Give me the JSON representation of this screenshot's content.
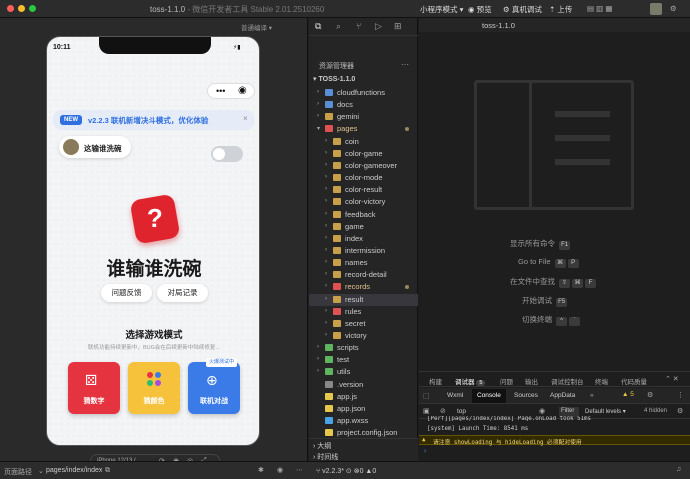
{
  "window": {
    "title": "toss-1.1.0",
    "subtitle": "- 微信开发者工具 Stable 2.01.2510260",
    "mode_select": "小程序模式",
    "preview_label": "预览",
    "real_debug_label": "真机调试",
    "upload_label": "上传",
    "compile_mode": "普通编译"
  },
  "editor_tab": "toss-1.1.0",
  "phone": {
    "time": "10:11",
    "banner_badge": "NEW",
    "banner_text": "v2.2.3 联机新增决斗模式，优化体验",
    "banner_close": "×",
    "user_label": "这输谁洗碗",
    "main_title": "谁输谁洗碗",
    "feedback_button": "问题反馈",
    "record_button": "对局记录",
    "section_title": "选择游戏模式",
    "section_subtitle": "联机功能持续更新中，BUG会在后续更新中陆续修复...",
    "modes": [
      {
        "label": "猜数字",
        "color": "#e63340"
      },
      {
        "label": "猜颜色",
        "color": "#f6c23b"
      },
      {
        "label": "联机对战",
        "color": "#3a7be8",
        "tag": "火爆测试中"
      }
    ],
    "device": "iPhone 12/13 (..."
  },
  "explorer": {
    "header": "资源管理器",
    "root": "TOSS-1.1.0",
    "items": [
      {
        "name": "cloudfunctions",
        "kind": "folder",
        "depth": 1
      },
      {
        "name": "docs",
        "kind": "folder",
        "depth": 1
      },
      {
        "name": "gemini",
        "kind": "folder",
        "depth": 1
      },
      {
        "name": "pages",
        "kind": "folder-open",
        "depth": 1,
        "modified": true
      },
      {
        "name": "coin",
        "kind": "folder",
        "depth": 2
      },
      {
        "name": "color-game",
        "kind": "folder",
        "depth": 2
      },
      {
        "name": "color-gameover",
        "kind": "folder",
        "depth": 2
      },
      {
        "name": "color-mode",
        "kind": "folder",
        "depth": 2
      },
      {
        "name": "color-result",
        "kind": "folder",
        "depth": 2
      },
      {
        "name": "color-victory",
        "kind": "folder",
        "depth": 2
      },
      {
        "name": "feedback",
        "kind": "folder",
        "depth": 2
      },
      {
        "name": "game",
        "kind": "folder",
        "depth": 2
      },
      {
        "name": "index",
        "kind": "folder",
        "depth": 2
      },
      {
        "name": "intermission",
        "kind": "folder",
        "depth": 2
      },
      {
        "name": "names",
        "kind": "folder",
        "depth": 2
      },
      {
        "name": "record-detail",
        "kind": "folder",
        "depth": 2
      },
      {
        "name": "records",
        "kind": "folder",
        "depth": 2,
        "modified": true
      },
      {
        "name": "result",
        "kind": "folder",
        "depth": 2,
        "selected": true
      },
      {
        "name": "rules",
        "kind": "folder",
        "depth": 2
      },
      {
        "name": "secret",
        "kind": "folder",
        "depth": 2
      },
      {
        "name": "victory",
        "kind": "folder",
        "depth": 2
      },
      {
        "name": "scripts",
        "kind": "folder",
        "depth": 1
      },
      {
        "name": "test",
        "kind": "folder",
        "depth": 1
      },
      {
        "name": "utils",
        "kind": "folder",
        "depth": 1
      },
      {
        "name": ".version",
        "kind": "file",
        "depth": 1
      },
      {
        "name": "app.js",
        "kind": "js",
        "depth": 1
      },
      {
        "name": "app.json",
        "kind": "json",
        "depth": 1
      },
      {
        "name": "app.wxss",
        "kind": "wxss",
        "depth": 1
      },
      {
        "name": "project.config.json",
        "kind": "json",
        "depth": 1
      }
    ],
    "outline": "大纲",
    "timeline": "时间线"
  },
  "commands": [
    {
      "label": "显示所有命令",
      "keys": [
        "F1"
      ]
    },
    {
      "label": "Go to File",
      "keys": [
        "⌘",
        "P"
      ]
    },
    {
      "label": "在文件中查找",
      "keys": [
        "⇧",
        "⌘",
        "F"
      ]
    },
    {
      "label": "开始调试",
      "keys": [
        "F5"
      ]
    },
    {
      "label": "切换终端",
      "keys": [
        "^",
        "`"
      ]
    }
  ],
  "devtools": {
    "tabs": [
      "构建",
      "调试器",
      "问题",
      "输出",
      "调试控制台",
      "终端",
      "代码质量"
    ],
    "debugger_count": "5",
    "subtabs": [
      "Wxml",
      "Console",
      "Sources",
      "AppData"
    ],
    "warn_count": "5",
    "context": "top",
    "filter_placeholder": "Filter",
    "levels": "Default levels",
    "hidden": "4 hidden",
    "logs": [
      "[system] Launch Time: 8541 ms",
      "请注意 showLoading 与 hideLoading 必须配对使用"
    ],
    "first_log_partial": "[Perf][pages/index/index] Page.onLoad took 51ms"
  },
  "status": {
    "path_label": "页面路径",
    "path": "pages/index/index",
    "branch": "v2.2.3*"
  }
}
